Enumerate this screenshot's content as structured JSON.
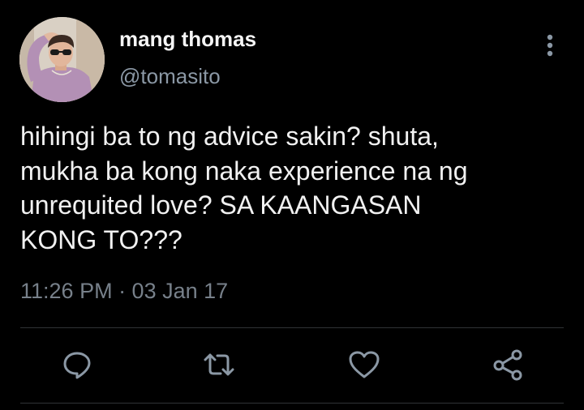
{
  "tweet": {
    "author": {
      "display_name": "mang thomas",
      "handle": "@tomasito"
    },
    "text_lines": [
      "hihingi ba to ng advice sakin? shuta,",
      "mukha ba kong naka experience na ng",
      "unrequited love? SA KAANGASAN",
      "KONG TO???"
    ],
    "timestamp": "11:26 PM · 03 Jan 17"
  },
  "actions": [
    "reply-icon",
    "retweet-icon",
    "like-icon",
    "share-icon"
  ],
  "colors": {
    "background": "#000000",
    "primary_text": "#f1f1f1",
    "secondary_text": "#8b98a5",
    "icon": "#8b98a5",
    "divider": "#2f3336"
  }
}
